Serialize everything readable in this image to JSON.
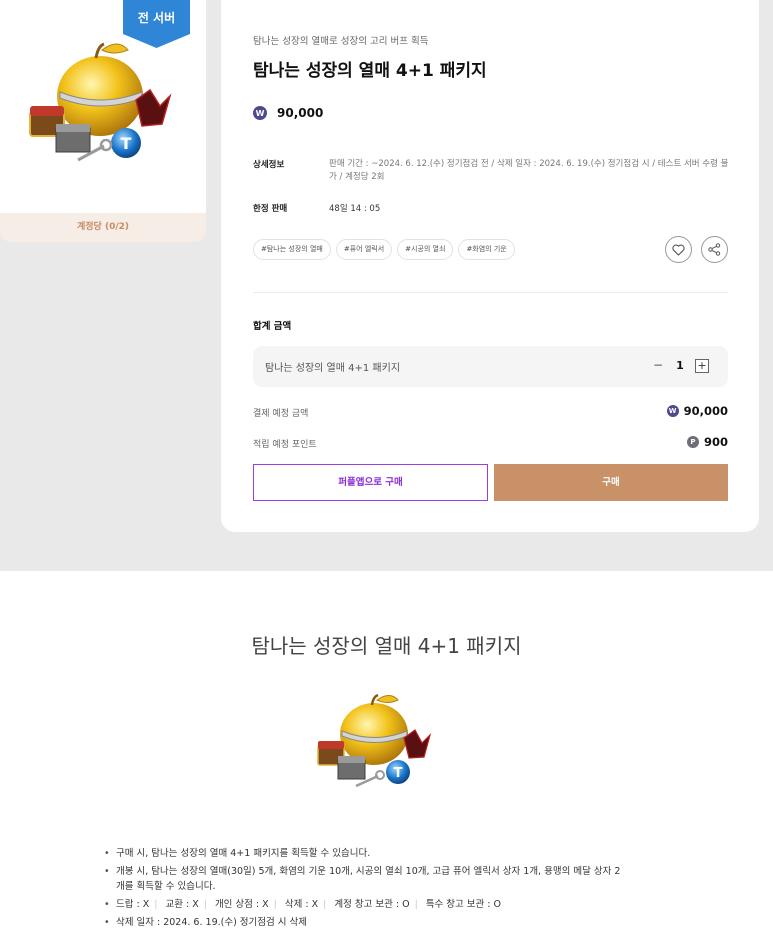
{
  "thumb": {
    "server_badge": "전 서버",
    "limit_label": "계정당 (0/2)"
  },
  "product": {
    "subtitle": "탐나는 성장의 열매로 성장의 고리 버프 획득",
    "title": "탐나는 성장의 열매 4+1 패키지",
    "currency_symbol": "W",
    "price": "90,000"
  },
  "details": {
    "info_label": "상세정보",
    "info_text": "판매 기간 : ~2024. 6. 12.(수) 정기점검 전 / 삭제 일자 : 2024. 6. 19.(수) 정기점검 시 / 테스트 서버 수령 불가 / 계정당 2회",
    "limited_label": "한정 판매",
    "timer": "48일 14 : 05"
  },
  "tags": [
    "#탐나는 성장의 열매",
    "#퓨어 엘릭서",
    "#시공의 열쇠",
    "#화염의 기운"
  ],
  "icons": {
    "like": "heart-icon",
    "share": "share-icon"
  },
  "summary": {
    "total_label": "합계 금액",
    "item_name": "탐나는 성장의 열매 4+1 패키지",
    "minus": "−",
    "quantity": "1",
    "plus": "+",
    "pay_label": "결제 예정 금액",
    "pay_symbol": "W",
    "pay_value": "90,000",
    "point_label": "적립 예정 포인트",
    "point_symbol": "P",
    "point_value": "900"
  },
  "buttons": {
    "purple_buy": "퍼플앱으로 구매",
    "buy": "구매"
  },
  "description": {
    "title": "탐나는 성장의 열매 4+1 패키지",
    "items": [
      "구매 시, 탐나는 성장의 열매 4+1 패키지를 획득할 수 있습니다.",
      "개봉 시, 탐나는 성장의 열매(30일) 5개, 화염의 기운 10개, 시공의 열쇠 10개, 고급 퓨어 엘릭서 상자 1개, 용맹의 메달 상자 2개를 획득할 수 있습니다.",
      "",
      "삭제 일자 : 2024. 6. 19.(수) 정기점검 시 삭제"
    ],
    "trade_flags": [
      "드랍 : X",
      "교환 : X",
      "개인 상점 : X",
      "삭제 : X",
      "계정 창고 보관 : O",
      "특수 창고 보관 : O"
    ]
  },
  "colors": {
    "accent_brown": "#c89168",
    "purple": "#9b3ee0",
    "coin": "#4f4a8f",
    "badge_blue": "#2f86d6"
  }
}
